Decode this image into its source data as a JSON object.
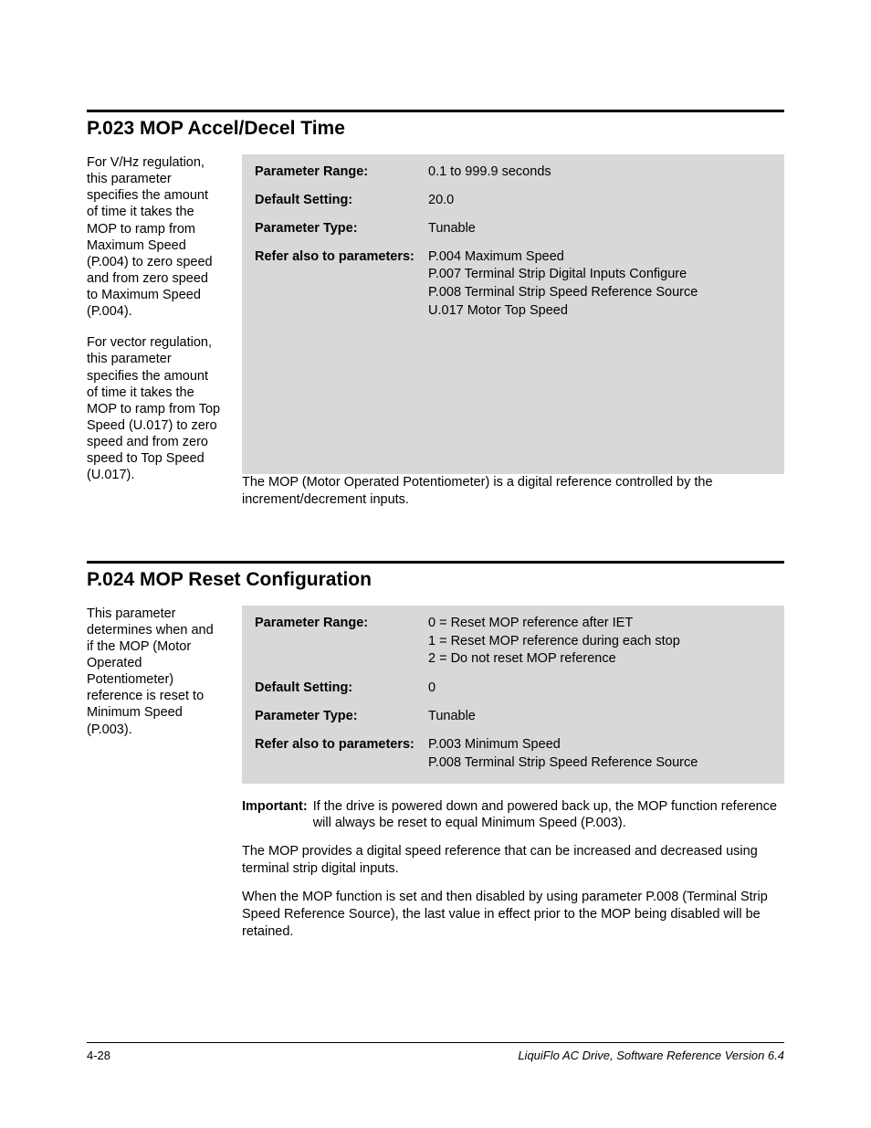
{
  "section1": {
    "title": "P.023 MOP Accel/Decel Time",
    "sidebar_p1": "For V/Hz regulation, this parameter specifies the amount of time it takes the MOP to ramp from Maximum Speed (P.004) to zero speed and from zero speed to Maximum Speed (P.004).",
    "sidebar_p2": "For vector regulation, this parameter specifies the amount of time it takes the MOP to ramp from Top Speed (U.017) to zero speed and from zero speed to Top Speed (U.017).",
    "labels": {
      "range": "Parameter Range:",
      "default": "Default Setting:",
      "type": "Parameter Type:",
      "refer": "Refer also to parameters:"
    },
    "values": {
      "range": "0.1 to 999.9 seconds",
      "default": "20.0",
      "type": "Tunable",
      "refer": [
        "P.004 Maximum Speed",
        "P.007 Terminal Strip Digital Inputs Configure",
        "P.008 Terminal Strip Speed Reference Source",
        "U.017 Motor Top Speed"
      ]
    },
    "desc": "The MOP (Motor Operated Potentiometer) is a digital reference controlled by the increment/decrement inputs."
  },
  "section2": {
    "title": "P.024 MOP Reset Configuration",
    "sidebar_p1": "This parameter determines when and if the MOP (Motor Operated Potentiometer) reference is reset to Minimum Speed (P.003).",
    "labels": {
      "range": "Parameter Range:",
      "default": "Default Setting:",
      "type": "Parameter Type:",
      "refer": "Refer also to parameters:"
    },
    "values": {
      "range": [
        "0 = Reset MOP reference after IET",
        "1 = Reset MOP reference during each stop",
        "2 = Do not reset MOP reference"
      ],
      "default": "0",
      "type": "Tunable",
      "refer": [
        "P.003 Minimum Speed",
        "P.008 Terminal Strip Speed Reference Source"
      ]
    },
    "important_label": "Important:",
    "important_text": "If the drive is powered down and powered back up, the MOP function reference will always be reset to equal Minimum Speed (P.003).",
    "desc1": "The MOP provides a digital speed reference that can be increased and decreased using terminal strip digital inputs.",
    "desc2": "When the MOP function is set and then disabled by using parameter P.008 (Terminal Strip Speed Reference Source), the last value in effect prior to the MOP being disabled will be retained."
  },
  "footer": {
    "left": "4-28",
    "right": "LiquiFlo AC Drive, Software Reference Version 6.4"
  }
}
